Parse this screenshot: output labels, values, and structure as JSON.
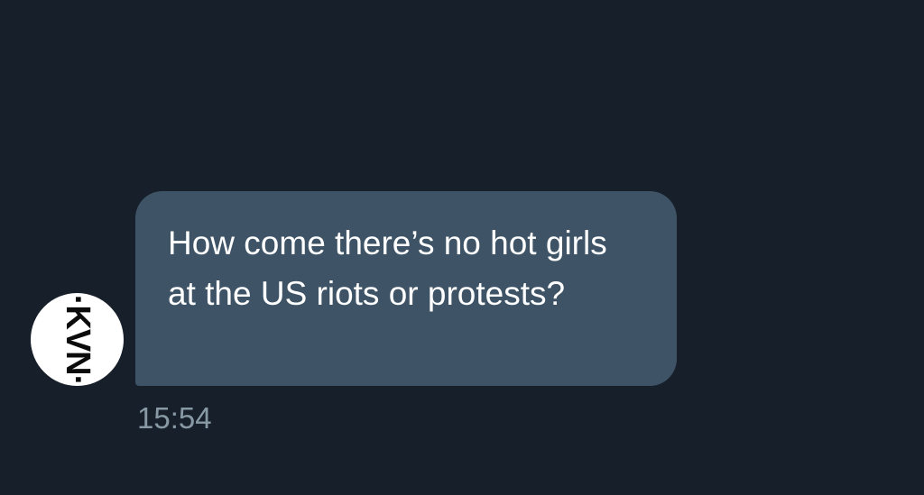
{
  "conversation": {
    "message": {
      "sender_avatar_text": "·KVN·",
      "text": "How come there’s no hot girls at the US riots or protests?",
      "timestamp": "15:54"
    }
  },
  "colors": {
    "background": "#17202a",
    "bubble": "#3e5466",
    "message_text": "#ffffff",
    "timestamp": "#8899a6",
    "avatar_bg": "#ffffff",
    "avatar_text": "#0b0b0b"
  }
}
